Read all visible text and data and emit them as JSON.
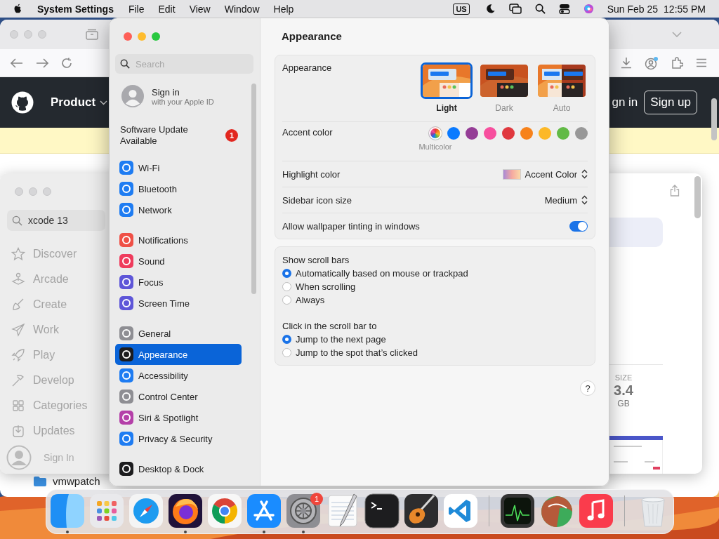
{
  "menu_bar": {
    "app_name": "System Settings",
    "menus": [
      "File",
      "Edit",
      "View",
      "Window",
      "Help"
    ],
    "input_source": "US",
    "date": "Sun Feb 25",
    "time": "12:55 PM"
  },
  "browser_window": {
    "nav_item": "Product",
    "sign_in": "gn in",
    "sign_up": "Sign up",
    "folder_item": "vmwpatch"
  },
  "app_store_window": {
    "search": {
      "value": "xcode 13"
    },
    "sidebar": [
      {
        "label": "Discover",
        "kind": "star"
      },
      {
        "label": "Arcade",
        "kind": "joystick"
      },
      {
        "label": "Create",
        "kind": "brush"
      },
      {
        "label": "Work",
        "kind": "plane"
      },
      {
        "label": "Play",
        "kind": "rocket"
      },
      {
        "label": "Develop",
        "kind": "hammer"
      },
      {
        "label": "Categories",
        "kind": "grid"
      },
      {
        "label": "Updates",
        "kind": "download"
      }
    ],
    "account": "Sign In",
    "size": {
      "label": "SIZE",
      "value": "3.4",
      "unit": "GB"
    }
  },
  "settings_window": {
    "search": {
      "placeholder": "Search"
    },
    "account": {
      "title": "Sign in",
      "subtitle": "with your Apple ID"
    },
    "update": {
      "label": "Software Update Available",
      "badge": "1"
    },
    "sidebar_groups": [
      [
        {
          "label": "Wi-Fi",
          "color": "#1e7cf2",
          "selected": false
        },
        {
          "label": "Bluetooth",
          "color": "#1e7cf2",
          "selected": false
        },
        {
          "label": "Network",
          "color": "#1e7cf2",
          "selected": false
        }
      ],
      [
        {
          "label": "Notifications",
          "color": "#ef5046",
          "selected": false
        },
        {
          "label": "Sound",
          "color": "#ef3b5c",
          "selected": false
        },
        {
          "label": "Focus",
          "color": "#5e56d8",
          "selected": false
        },
        {
          "label": "Screen Time",
          "color": "#5e56d8",
          "selected": false
        }
      ],
      [
        {
          "label": "General",
          "color": "#8e8e93",
          "selected": false
        },
        {
          "label": "Appearance",
          "color": "#1c1c1e",
          "selected": true
        },
        {
          "label": "Accessibility",
          "color": "#1e7cf2",
          "selected": false
        },
        {
          "label": "Control Center",
          "color": "#8e8e93",
          "selected": false
        },
        {
          "label": "Siri & Spotlight",
          "color": "#b43fa8",
          "selected": false
        },
        {
          "label": "Privacy & Security",
          "color": "#1e7cf2",
          "selected": false
        }
      ],
      [
        {
          "label": "Desktop & Dock",
          "color": "#1c1c1e",
          "selected": false
        }
      ]
    ],
    "page_title": "Appearance",
    "appearance": {
      "label": "Appearance",
      "options": [
        {
          "label": "Light",
          "kind": "light",
          "selected": true
        },
        {
          "label": "Dark",
          "kind": "dark",
          "selected": false
        },
        {
          "label": "Auto",
          "kind": "auto",
          "selected": false
        }
      ]
    },
    "accent": {
      "label": "Accent color",
      "caption": "Multicolor",
      "colors": [
        {
          "kind": "multicolor",
          "selected": true
        },
        {
          "kind": "solid",
          "color": "#0a7aff",
          "selected": false
        },
        {
          "kind": "solid",
          "color": "#953d96",
          "selected": false
        },
        {
          "kind": "solid",
          "color": "#f74f9e",
          "selected": false
        },
        {
          "kind": "solid",
          "color": "#e0383e",
          "selected": false
        },
        {
          "kind": "solid",
          "color": "#f7821b",
          "selected": false
        },
        {
          "kind": "solid",
          "color": "#fcb827",
          "selected": false
        },
        {
          "kind": "solid",
          "color": "#62ba46",
          "selected": false
        },
        {
          "kind": "solid",
          "color": "#989898",
          "selected": false
        }
      ]
    },
    "highlight": {
      "label": "Highlight color",
      "value": "Accent Color"
    },
    "icon_size": {
      "label": "Sidebar icon size",
      "value": "Medium"
    },
    "tinting": {
      "label": "Allow wallpaper tinting in windows",
      "on": true
    },
    "scroll_bars": {
      "label": "Show scroll bars",
      "options": [
        {
          "label": "Automatically based on mouse or trackpad",
          "selected": true
        },
        {
          "label": "When scrolling",
          "selected": false
        },
        {
          "label": "Always",
          "selected": false
        }
      ]
    },
    "click_scroll": {
      "label": "Click in the scroll bar to",
      "options": [
        {
          "label": "Jump to the next page",
          "selected": true
        },
        {
          "label": "Jump to the spot that’s clicked",
          "selected": false
        }
      ]
    },
    "help_button": "?"
  },
  "dock": [
    {
      "kind": "finder",
      "running": true
    },
    {
      "kind": "launchpad",
      "running": false
    },
    {
      "kind": "safari",
      "running": false
    },
    {
      "kind": "firefox",
      "running": true
    },
    {
      "kind": "chrome",
      "running": false
    },
    {
      "kind": "appstore",
      "running": true
    },
    {
      "kind": "settings",
      "running": true,
      "badge": "1"
    },
    {
      "kind": "textedit",
      "running": false
    },
    {
      "kind": "terminal",
      "running": false
    },
    {
      "kind": "garageband",
      "running": false
    },
    {
      "kind": "vscode",
      "running": false
    },
    {
      "kind": "separator"
    },
    {
      "kind": "activity",
      "running": false
    },
    {
      "kind": "reaper",
      "running": false
    },
    {
      "kind": "music",
      "running": false
    },
    {
      "kind": "separator"
    },
    {
      "kind": "trash",
      "running": false
    }
  ]
}
